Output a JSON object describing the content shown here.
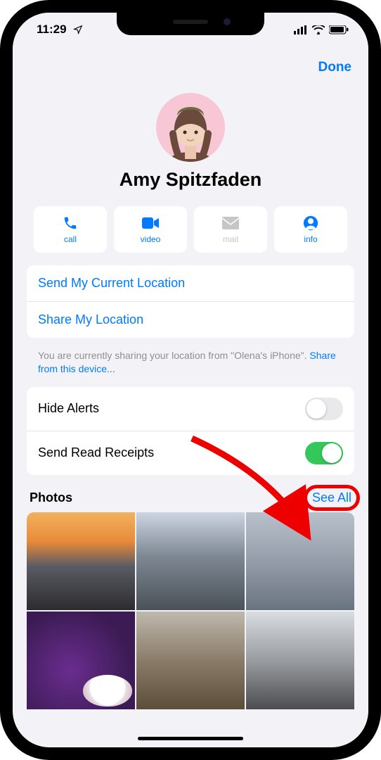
{
  "status": {
    "time": "11:29",
    "location_icon": "location-arrow-icon",
    "signal_icon": "cellular-icon",
    "wifi_icon": "wifi-icon",
    "battery_icon": "battery-icon"
  },
  "header": {
    "done_label": "Done"
  },
  "contact": {
    "name": "Amy Spitzfaden"
  },
  "actions": {
    "call": {
      "label": "call",
      "icon": "phone-icon"
    },
    "video": {
      "label": "video",
      "icon": "video-icon"
    },
    "mail": {
      "label": "mail",
      "icon": "mail-icon",
      "disabled": true
    },
    "info": {
      "label": "info",
      "icon": "info-icon"
    }
  },
  "location_block": {
    "send_current": "Send My Current Location",
    "share": "Share My Location"
  },
  "footnote": {
    "prefix": "You are currently sharing your location from \"Olena's iPhone\". ",
    "link": "Share from this device..."
  },
  "settings": {
    "hide_alerts": {
      "label": "Hide Alerts",
      "value": false
    },
    "read_receipts": {
      "label": "Send Read Receipts",
      "value": true
    }
  },
  "photos": {
    "title": "Photos",
    "see_all": "See All"
  },
  "annotations": {
    "see_all_highlight_color": "#ef0000",
    "arrow_color": "#ef0000"
  }
}
